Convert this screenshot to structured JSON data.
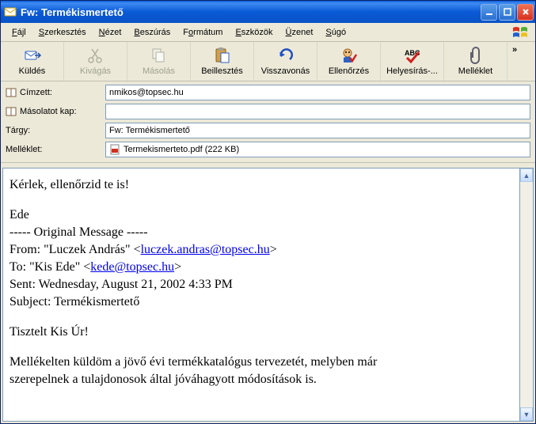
{
  "window": {
    "title": "Fw: Termékismertető"
  },
  "menus": {
    "file": {
      "label": "Fájl",
      "u": "F"
    },
    "edit": {
      "label": "Szerkesztés",
      "u": "S"
    },
    "view": {
      "label": "Nézet",
      "u": "N"
    },
    "insert": {
      "label": "Beszúrás",
      "u": "B"
    },
    "format": {
      "label": "Formátum",
      "u": "F"
    },
    "tools": {
      "label": "Eszközök",
      "u": "E"
    },
    "message": {
      "label": "Üzenet",
      "u": "Ü"
    },
    "help": {
      "label": "Súgó",
      "u": "S"
    }
  },
  "toolbar": {
    "send": "Küldés",
    "cut": "Kivágás",
    "copy": "Másolás",
    "paste": "Beillesztés",
    "undo": "Visszavonás",
    "check": "Ellenőrzés",
    "spell": "Helyesírás-...",
    "attach": "Melléklet"
  },
  "fields": {
    "to_label": "Címzett:",
    "cc_label": "Másolatot kap:",
    "subject_label": "Tárgy:",
    "attach_label": "Melléklet:",
    "to_value": "nmikos@topsec.hu",
    "cc_value": "",
    "subject_value": "Fw: Termékismertető",
    "attachment_name": "Termekismerteto.pdf (222 KB)"
  },
  "body": {
    "l1": "Kérlek, ellenőrzid te is!",
    "l2": "Ede",
    "l3": "----- Original Message -----",
    "l4a": "From: \"Luczek András\" <",
    "l4b": "luczek.andras@topsec.hu",
    "l4c": ">",
    "l5a": "To: \"Kis Ede\" <",
    "l5b": "kede@topsec.hu",
    "l5c": ">",
    "l6": "Sent: Wednesday, August 21, 2002 4:33 PM",
    "l7": "Subject: Termékismertető",
    "l8": "Tisztelt Kis Úr!",
    "l9": "Mellékelten küldöm a jövő évi termékkatalógus tervezetét, melyben már",
    "l10": "szerepelnek a tulajdonosok által jóváhagyott módosítások is."
  }
}
